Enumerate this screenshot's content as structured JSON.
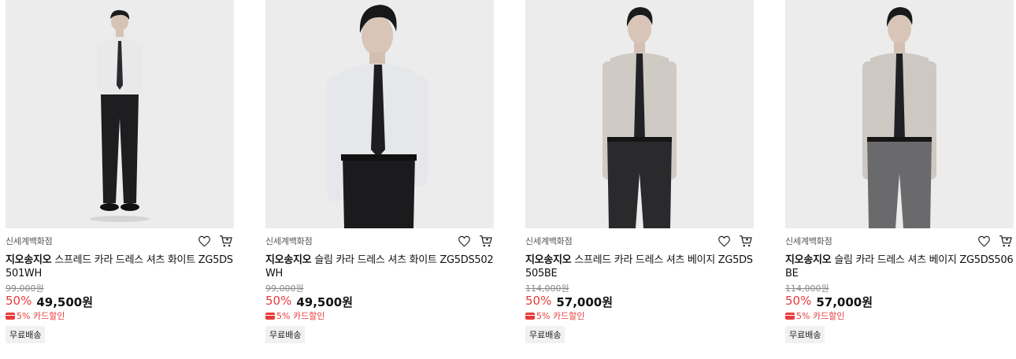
{
  "products": [
    {
      "store": "신세계백화점",
      "brand": "지오송지오",
      "name": "스프레드 카라 드레스 셔츠 화이트 ZG5DS 501WH",
      "original_price": "99,000원",
      "discount": "50%",
      "price": "49,500원",
      "card_discount": "5% 카드할인",
      "shipping": "무료배송",
      "shirt_color": "#e9e9ea",
      "pants_color": "#1e1e20",
      "tie_color": "#2a2a30",
      "framing": "full"
    },
    {
      "store": "신세계백화점",
      "brand": "지오송지오",
      "name": "슬림 카라 드레스 셔츠 화이트 ZG5DS502 WH",
      "original_price": "99,000원",
      "discount": "50%",
      "price": "49,500원",
      "card_discount": "5% 카드할인",
      "shipping": "무료배송",
      "shirt_color": "#e6e7ea",
      "pants_color": "#1b1b1d",
      "tie_color": "#1e1e22",
      "framing": "close"
    },
    {
      "store": "신세계백화점",
      "brand": "지오송지오",
      "name": "스프레드 카라 드레스 셔츠 베이지 ZG5DS 505BE",
      "original_price": "114,000원",
      "discount": "50%",
      "price": "57,000원",
      "card_discount": "5% 카드할인",
      "shipping": "무료배송",
      "shirt_color": "#cfcac4",
      "pants_color": "#2a2a2c",
      "tie_color": "#222226",
      "framing": "mid"
    },
    {
      "store": "신세계백화점",
      "brand": "지오송지오",
      "name": "슬림 카라 드레스 셔츠 베이지 ZG5DS506 BE",
      "original_price": "114,000원",
      "discount": "50%",
      "price": "57,000원",
      "card_discount": "5% 카드할인",
      "shipping": "무료배송",
      "shirt_color": "#cdc8c2",
      "pants_color": "#6a6a6c",
      "tie_color": "#1f1f24",
      "framing": "mid"
    }
  ],
  "icons": {
    "wishlist": "heart-icon",
    "cart": "cart-icon"
  },
  "colors": {
    "accent_red": "#e83b3b",
    "photo_bg": "#ececec"
  }
}
